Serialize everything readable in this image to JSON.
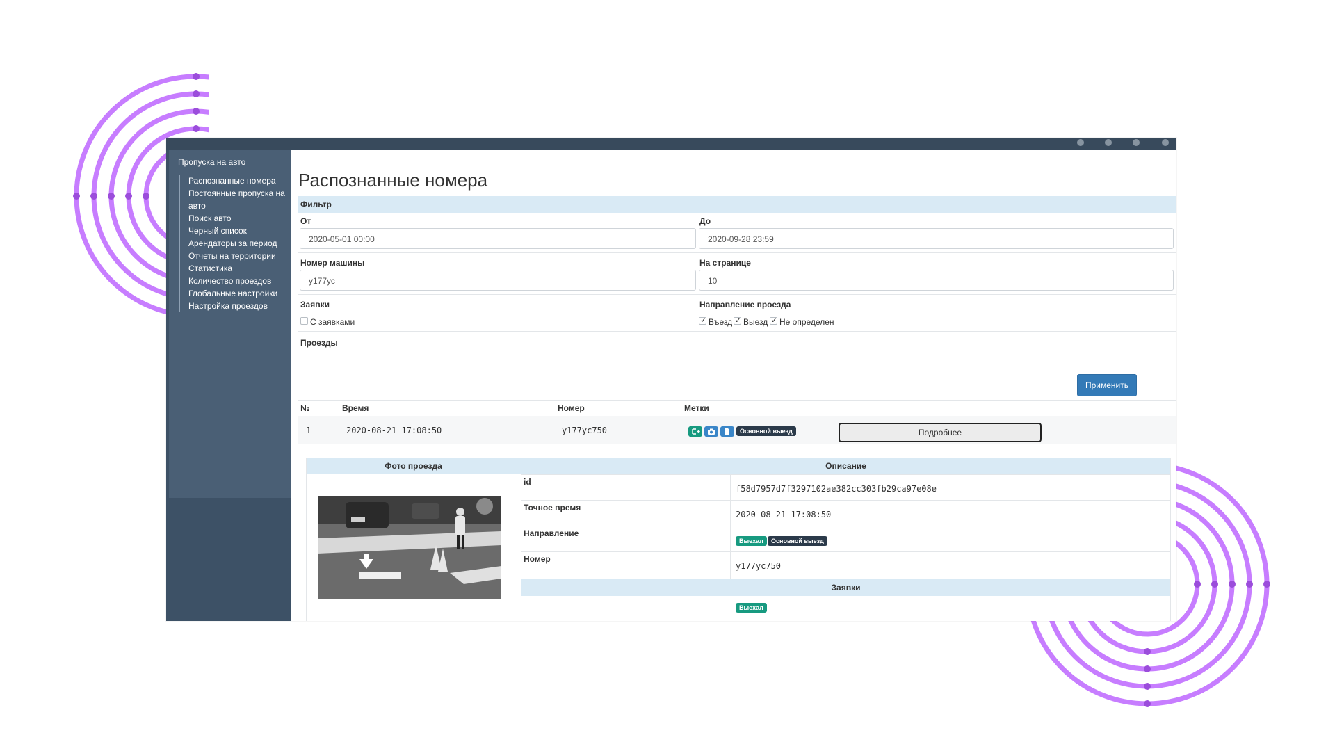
{
  "sidebar": {
    "title": "Пропуска на авто",
    "items": [
      {
        "label": "Распознанные номера"
      },
      {
        "label": "Постоянные пропуска на авто"
      },
      {
        "label": "Поиск авто"
      },
      {
        "label": "Черный список"
      },
      {
        "label": "Арендаторы за период"
      },
      {
        "label": "Отчеты на территории"
      },
      {
        "label": "Статистика"
      },
      {
        "label": "Количество проездов"
      },
      {
        "label": "Глобальные настройки"
      },
      {
        "label": "Настройка проездов"
      }
    ]
  },
  "page": {
    "title": "Распознанные номера"
  },
  "filter": {
    "header": "Фильтр",
    "from_label": "От",
    "from_value": "2020-05-01 00:00",
    "to_label": "До",
    "to_value": "2020-09-28 23:59",
    "plate_label": "Номер машины",
    "plate_value": "у177ус",
    "per_page_label": "На странице",
    "per_page_value": "10",
    "requests_label": "Заявки",
    "with_requests_label": "С заявками",
    "with_requests_checked": false,
    "direction_label": "Направление проезда",
    "direction_options": [
      {
        "label": "Въезд",
        "checked": true
      },
      {
        "label": "Выезд",
        "checked": true
      },
      {
        "label": "Не определен",
        "checked": true
      }
    ],
    "passes_label": "Проезды",
    "apply_label": "Применить"
  },
  "results": {
    "columns": {
      "num": "№",
      "time": "Время",
      "plate": "Номер",
      "tags": "Метки"
    },
    "rows": [
      {
        "num": "1",
        "time": "2020-08-21 17:08:50",
        "plate": "у177ус750",
        "tag_icons": [
          "exit-icon",
          "camera-icon",
          "document-icon"
        ],
        "tag_badge": "Основной выезд",
        "details_label": "Подробнее"
      }
    ]
  },
  "details": {
    "photo_header": "Фото проезда",
    "desc_header": "Описание",
    "fields": [
      {
        "key": "id",
        "value": "f58d7957d7f3297102ae382cc303fb29ca97e08e"
      },
      {
        "key": "Точное время",
        "value": "2020-08-21 17:08:50"
      },
      {
        "key": "Направление",
        "badges": [
          "Выехал",
          "Основной выезд"
        ]
      },
      {
        "key": "Номер",
        "value": "у177ус750"
      }
    ],
    "requests_header": "Заявки",
    "requests_badge": "Выехал"
  },
  "colors": {
    "accent": "#337ab7",
    "decor_arcs": "#c77dff",
    "sidebar_bg": "#3d5166",
    "table_header_bg": "#d9eaf5",
    "badge_green": "#179a80",
    "badge_dark": "#2b3a4a"
  }
}
